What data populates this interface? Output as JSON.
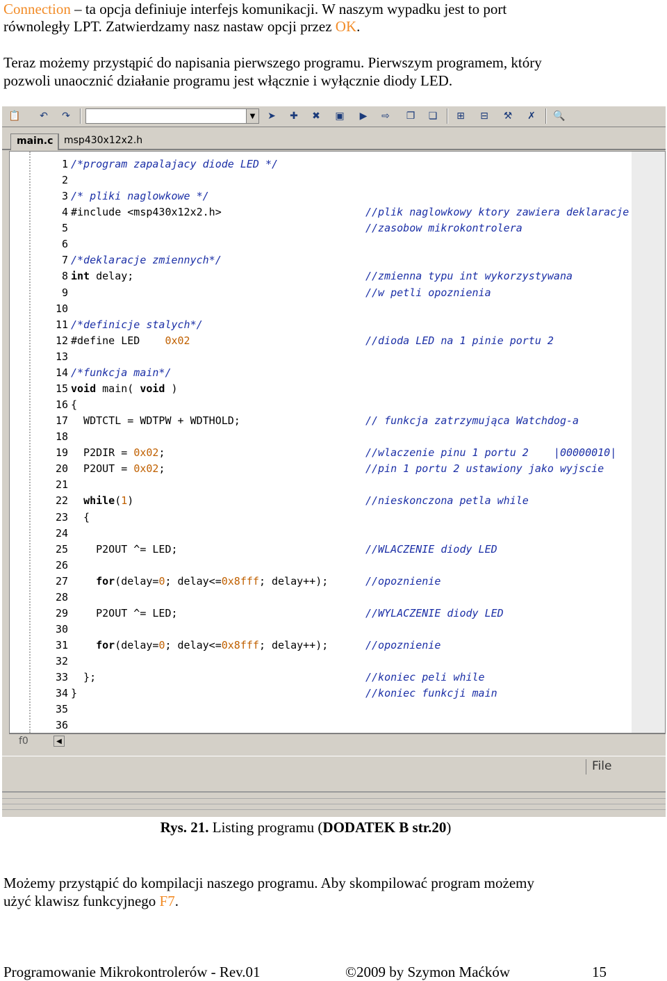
{
  "intro": {
    "line1_keyword": "Connection",
    "line1_rest": " – ta opcja definiuje interfejs komunikacji. W naszym wypadku jest to port",
    "line2_text": "równoległy LPT. Zatwierdzamy nasz nastaw opcji przez ",
    "line2_ok": "OK",
    "line2_end": ".",
    "line3": "Teraz możemy przystąpić do napisania pierwszego programu. Pierwszym programem, który",
    "line4": "pozwoli unaocznić działanie programu jest włącznie i wyłącznie diody LED."
  },
  "ide": {
    "tabs": {
      "active": "main.c",
      "inactive": "msp430x12x2.h"
    },
    "toolbar_icons": [
      "paste-icon",
      "undo-icon",
      "redo-icon",
      "combo-dropdown",
      "breakpoint-icon",
      "breakpoint-add-icon",
      "breakpoint-remove-icon",
      "calc-icon",
      "run-icon",
      "step-icon",
      "copy-icon",
      "copy2-icon",
      "debug-icon",
      "watch-icon",
      "tool-icon",
      "delete-icon",
      "find-icon"
    ],
    "hscroll_label": "f0",
    "status_file": "File",
    "code_lines": [
      {
        "n": "1",
        "code": "",
        "cmt": "",
        "full_comment": "/*program zapalajacy diode LED */"
      },
      {
        "n": "2",
        "code": "",
        "cmt": ""
      },
      {
        "n": "3",
        "code": "",
        "cmt": "",
        "full_comment": "/* pliki naglowkowe */"
      },
      {
        "n": "4",
        "code": "#include <msp430x12x2.h>",
        "cmt": "//plik naglowkowy ktory zawiera deklaracje"
      },
      {
        "n": "5",
        "code": "",
        "cmt": "//zasobow mikrokontrolera"
      },
      {
        "n": "6",
        "code": "",
        "cmt": ""
      },
      {
        "n": "7",
        "code": "",
        "cmt": "",
        "full_comment": "/*deklaracje zmiennych*/"
      },
      {
        "n": "8",
        "kw": "int",
        "code": " delay;",
        "cmt": "//zmienna typu int wykorzystywana"
      },
      {
        "n": "9",
        "code": "",
        "cmt": "//w petli opoznienia"
      },
      {
        "n": "10",
        "code": "",
        "cmt": ""
      },
      {
        "n": "11",
        "code": "",
        "cmt": "",
        "full_comment": "/*definicje stalych*/"
      },
      {
        "n": "12",
        "code": "#define LED    ",
        "num": "0x02",
        "cmt": "//dioda LED na 1 pinie portu 2"
      },
      {
        "n": "13",
        "code": "",
        "cmt": ""
      },
      {
        "n": "14",
        "code": "",
        "cmt": "",
        "full_comment": "/*funkcja main*/"
      },
      {
        "n": "15",
        "kw": "void",
        "code": " main( ",
        "kw2": "void",
        "code2": " )",
        "cmt": ""
      },
      {
        "n": "16",
        "code": "{",
        "cmt": ""
      },
      {
        "n": "17",
        "code": "  WDTCTL = WDTPW + WDTHOLD;",
        "cmt": "// funkcja zatrzymująca Watchdog-a"
      },
      {
        "n": "18",
        "code": "",
        "cmt": ""
      },
      {
        "n": "19",
        "code": "  P2DIR = ",
        "num": "0x02",
        "code2": ";",
        "cmt": "//wlaczenie pinu 1 portu 2    |00000010|"
      },
      {
        "n": "20",
        "code": "  P2OUT = ",
        "num": "0x02",
        "code2": ";",
        "cmt": "//pin 1 portu 2 ustawiony jako wyjscie"
      },
      {
        "n": "21",
        "code": "",
        "cmt": ""
      },
      {
        "n": "22",
        "pre": "  ",
        "kw": "while",
        "code": "(",
        "num": "1",
        "code2": ")",
        "cmt": "//nieskonczona petla while"
      },
      {
        "n": "23",
        "code": "  {",
        "cmt": ""
      },
      {
        "n": "24",
        "code": "",
        "cmt": ""
      },
      {
        "n": "25",
        "code": "    P2OUT ^= LED;",
        "cmt": "//WLACZENIE diody LED"
      },
      {
        "n": "26",
        "code": "",
        "cmt": ""
      },
      {
        "n": "27",
        "pre": "    ",
        "kw": "for",
        "code": "(delay=",
        "num": "0",
        "code2": "; delay<=",
        "num2": "0x8fff",
        "code3": "; delay++);",
        "cmt": "//opoznienie"
      },
      {
        "n": "28",
        "code": "",
        "cmt": ""
      },
      {
        "n": "29",
        "code": "    P2OUT ^= LED;",
        "cmt": "//WYLACZENIE diody LED"
      },
      {
        "n": "30",
        "code": "",
        "cmt": ""
      },
      {
        "n": "31",
        "pre": "    ",
        "kw": "for",
        "code": "(delay=",
        "num": "0",
        "code2": "; delay<=",
        "num2": "0x8fff",
        "code3": "; delay++);",
        "cmt": "//opoznienie"
      },
      {
        "n": "32",
        "code": "",
        "cmt": ""
      },
      {
        "n": "33",
        "code": "  };",
        "cmt": "//koniec peli while"
      },
      {
        "n": "34",
        "code": "}",
        "cmt": "//koniec funkcji main"
      },
      {
        "n": "35",
        "code": "",
        "cmt": ""
      },
      {
        "n": "36",
        "code": "",
        "cmt": ""
      }
    ]
  },
  "caption": {
    "bold1": "Rys. 21.",
    "normal": " Listing programu (",
    "bold2": "DODATEK B str.",
    "bold3": "20",
    "end": ")"
  },
  "outro": {
    "line1": "Możemy przystąpić do kompilacji naszego programu. Aby skompilować program możemy",
    "line2_text": "użyć klawisz funkcyjnego ",
    "line2_key": "F7",
    "line2_end": "."
  },
  "footer": {
    "left": "Programowanie Mikrokontrolerów - Rev.01",
    "center": "©2009  by  Szymon Maćków",
    "page": "15"
  },
  "colors": {
    "orange": "#f28c28",
    "comment_blue": "#1b2fa6",
    "number": "#c06000",
    "ide_gray": "#d4d0c8"
  }
}
